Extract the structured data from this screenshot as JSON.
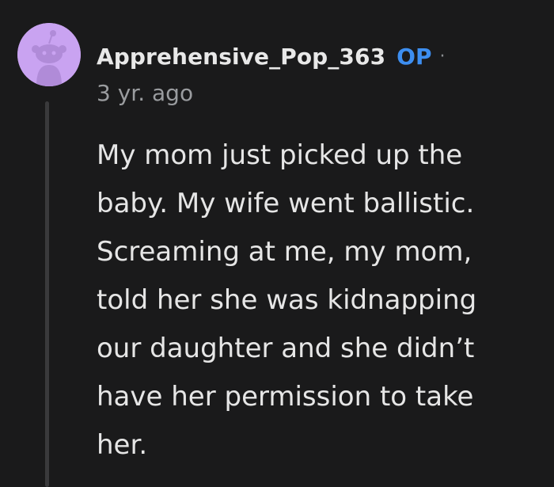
{
  "comment": {
    "avatar_icon": "snoo-avatar-icon",
    "avatar_color": "#c9a3f1",
    "author": "Apprehensive_Pop_363",
    "op_badge": "OP",
    "separator": "·",
    "timestamp": "3 yr. ago",
    "body": "My mom just picked up the\nbaby. My wife went ballistic.\nScreaming at me, my mom,\ntold her she was kidnapping\nour daughter and she didn’t\nhave her permission to take\nher."
  },
  "colors": {
    "background": "#1a1a1b",
    "op_badge": "#3d8ef0",
    "thread_line": "#3a3a3c"
  }
}
